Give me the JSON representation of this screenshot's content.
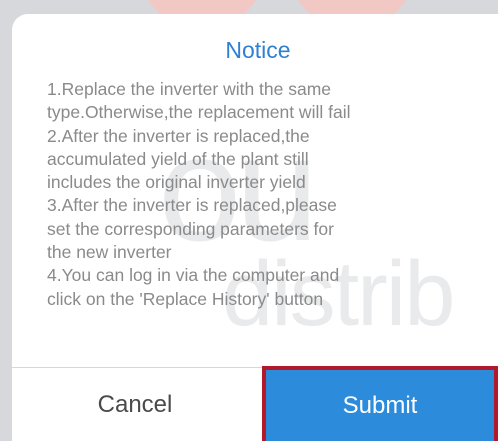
{
  "dialog": {
    "title": "Notice",
    "lines": [
      "1.Replace the inverter with the same",
      "type.Otherwise,the replacement will fail",
      "2.After the inverter is replaced,the",
      "accumulated yield of the plant still",
      "includes the original inverter yield",
      "3.After the inverter is replaced,please",
      "set the corresponding parameters for",
      "the new inverter",
      "4.You can log in via the computer and",
      "click on the 'Replace History' button"
    ],
    "cancel_label": "Cancel",
    "submit_label": "Submit"
  },
  "colors": {
    "title": "#2f7fd3",
    "submit_bg": "#2d8bdc",
    "highlight_border": "#b01a2b",
    "body_text": "#8a8a8a"
  }
}
